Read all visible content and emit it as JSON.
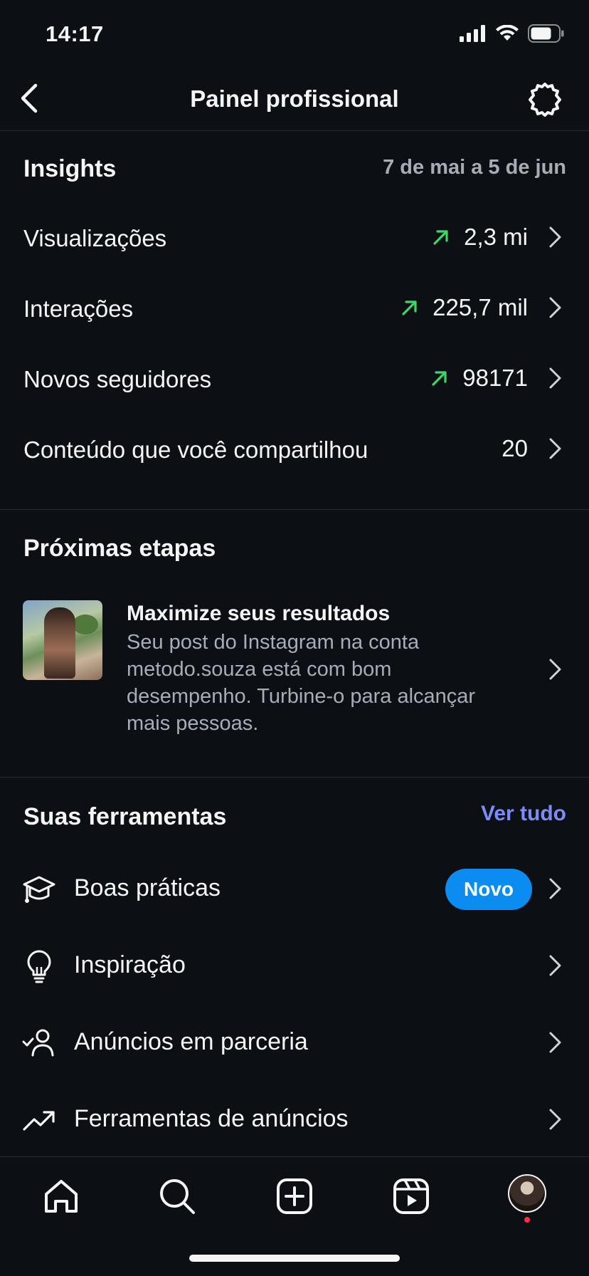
{
  "status": {
    "time": "14:17",
    "icons": [
      "signal-icon",
      "wifi-icon",
      "battery-icon"
    ]
  },
  "nav": {
    "title": "Painel profissional",
    "back_icon": "chevron-left-icon",
    "settings_icon": "settings-icon"
  },
  "insights": {
    "title": "Insights",
    "range": "7 de mai a 5 de jun",
    "metrics": [
      {
        "label": "Visualizações",
        "value": "2,3 mi",
        "trend": "up"
      },
      {
        "label": "Interações",
        "value": "225,7 mil",
        "trend": "up"
      },
      {
        "label": "Novos seguidores",
        "value": "98171",
        "trend": "up"
      },
      {
        "label": "Conteúdo que você compartilhou",
        "value": "20",
        "trend": "none"
      }
    ]
  },
  "next_steps": {
    "title": "Próximas etapas",
    "card": {
      "title": "Maximize seus resultados",
      "body": "Seu post do Instagram na conta metodo.souza está com bom desempenho. Turbine-o para alcançar mais pessoas."
    }
  },
  "tools": {
    "title": "Suas ferramentas",
    "see_all": "Ver tudo",
    "items": [
      {
        "label": "Boas práticas",
        "icon": "graduation-cap-icon",
        "badge": "Novo"
      },
      {
        "label": "Inspiração",
        "icon": "lightbulb-icon"
      },
      {
        "label": "Anúncios em parceria",
        "icon": "person-check-icon"
      },
      {
        "label": "Ferramentas de anúncios",
        "icon": "trending-up-icon"
      }
    ]
  },
  "tabbar": {
    "tabs": [
      "home-icon",
      "search-icon",
      "create-icon",
      "reels-icon",
      "profile-avatar"
    ]
  },
  "colors": {
    "background": "#0c1014",
    "trend_green": "#3dd66b",
    "link": "#7b8cfb",
    "badge": "#0a8cf0",
    "notification": "#ff3040"
  }
}
